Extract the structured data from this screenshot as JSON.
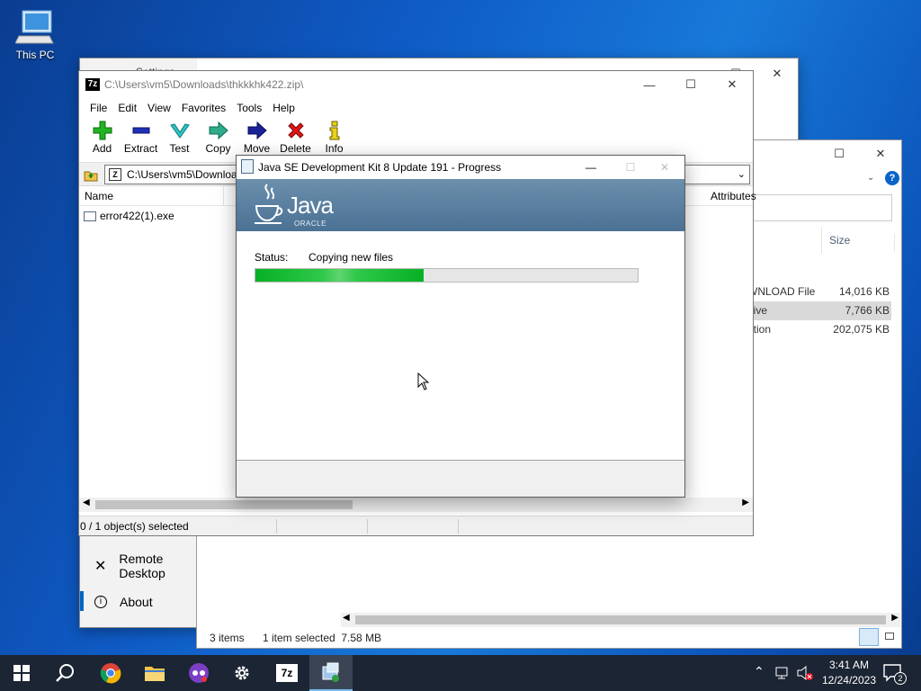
{
  "desktop": {
    "icon_label": "This PC"
  },
  "settings": {
    "title": "Settings",
    "items": [
      {
        "label": "Remote Desktop"
      },
      {
        "label": "About"
      }
    ]
  },
  "explorer": {
    "col_size": "Size",
    "rows": [
      {
        "type": "WNLOAD File",
        "size": "14,016 KB"
      },
      {
        "type": "hive",
        "size": "7,766 KB"
      },
      {
        "type": "ation",
        "size": "202,075 KB"
      }
    ],
    "status_items": "3 items",
    "status_selected": "1 item selected  7.58 MB"
  },
  "sevenzip": {
    "title": "C:\\Users\\vm5\\Downloads\\thkkkhk422.zip\\",
    "menu": [
      "File",
      "Edit",
      "View",
      "Favorites",
      "Tools",
      "Help"
    ],
    "toolbar": [
      "Add",
      "Extract",
      "Test",
      "Copy",
      "Move",
      "Delete",
      "Info"
    ],
    "address": "C:\\Users\\vm5\\Downloads\\thkkkhk422.zip\\",
    "col_name": "Name",
    "col_attributes": "Attributes",
    "file": "error422(1).exe",
    "status": "0 / 1 object(s) selected"
  },
  "java": {
    "title": "Java SE Development Kit 8 Update 191 - Progress",
    "logo_text": "Java",
    "logo_sub": "ORACLE",
    "status_label": "Status:",
    "status_value": "Copying new files",
    "progress": 0.44
  },
  "taskbar": {
    "time": "3:41 AM",
    "date": "12/24/2023",
    "notifications": "2"
  }
}
